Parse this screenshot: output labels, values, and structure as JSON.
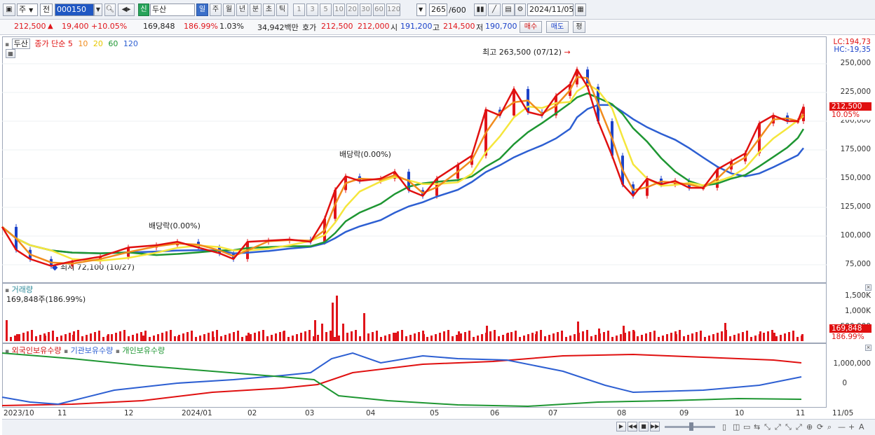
{
  "toolbar": {
    "period_select": "주",
    "mode_select": "전",
    "stock_code": "000150",
    "market_tag": "신",
    "stock_name": "두산",
    "period_tabs": [
      "일",
      "주",
      "월",
      "년",
      "분",
      "초",
      "틱"
    ],
    "interval_buttons": [
      "1",
      "3",
      "5",
      "10",
      "20",
      "30",
      "60",
      "120"
    ],
    "count_display": "265",
    "count_max": "/600",
    "date_field": "2024/11/05"
  },
  "quote": {
    "price": "212,500",
    "change": "19,400",
    "change_pct": "+10.05%",
    "volume": "169,848",
    "volume_ratio": "186.99%",
    "turnover_pct": "1.03%",
    "trade_value": "34,942백만",
    "bid_label": "호가",
    "bid": "212,500",
    "ask": "212,000",
    "open_label": "시",
    "open": "191,200",
    "high_label": "고",
    "high": "214,500",
    "low_label": "저",
    "low": "190,700",
    "buy_button": "매수",
    "sell_button": "매도",
    "extra_button": "평"
  },
  "price_pane": {
    "title": "두산",
    "ma_label": "종가 단순",
    "ma_periods": [
      "5",
      "10",
      "20",
      "60",
      "120"
    ],
    "lc_label": "LC:194,73",
    "hc_label": "HC:-19,35",
    "axis_labels": [
      "250,000",
      "225,000",
      "200,000",
      "175,000",
      "150,000",
      "125,000",
      "100,000",
      "75,000"
    ],
    "high_annotation": "최고 263,500 (07/12)",
    "low_annotation": "최저 72,100 (10/27)",
    "dividend_1": "배당락(0.00%)",
    "dividend_2": "배당락(0.00%)",
    "current_price_box": "212,500",
    "current_pct_box": "10.05%"
  },
  "volume_pane": {
    "title": "거래량",
    "value_label": "169,848주(186.99%)",
    "axis_labels": [
      "1,500K",
      "1,000K",
      "500,000"
    ],
    "current_box": "169,848",
    "current_pct_box": "186.99%"
  },
  "holding_pane": {
    "series_labels": [
      "외국인보유수량",
      "기관보유수량",
      "개인보유수량"
    ],
    "axis_labels": [
      "1,000,000",
      "0"
    ]
  },
  "x_axis_labels": [
    "2023/10",
    "11",
    "12",
    "2024/01",
    "02",
    "03",
    "04",
    "05",
    "06",
    "07",
    "08",
    "09",
    "10",
    "11",
    "11/05"
  ],
  "colors": {
    "ma5": "#e01010",
    "ma10": "#f08c1e",
    "ma20": "#f5e63c",
    "ma60": "#1e9632",
    "ma120": "#2d5fd2",
    "up": "#e0151b",
    "down": "#1c43c9"
  }
}
